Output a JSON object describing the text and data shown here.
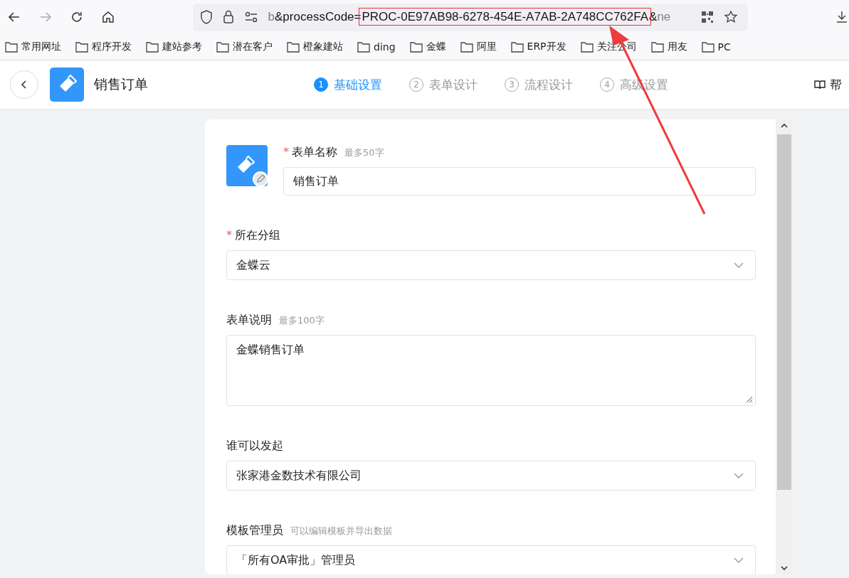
{
  "browser": {
    "url_parts": [
      {
        "text": "b",
        "kind": "faded"
      },
      {
        "text": "&processCode=",
        "kind": "normal"
      },
      {
        "text": "PROC-0E97AB98-6278-454E-A7AB-2A748CC762FA",
        "kind": "highlight"
      },
      {
        "text": "&",
        "kind": "normal"
      },
      {
        "text": "ne",
        "kind": "faded"
      }
    ],
    "bookmarks": [
      "常用网址",
      "程序开发",
      "建站参考",
      "潜在客户",
      "橙象建站",
      "ding",
      "金蝶",
      "阿里",
      "ERP开发",
      "关注公司",
      "用友",
      "PC"
    ]
  },
  "header": {
    "title": "销售订单",
    "help": "帮",
    "steps": [
      {
        "number": "1",
        "label": "基础设置",
        "selected": true
      },
      {
        "number": "2",
        "label": "表单设计",
        "selected": false
      },
      {
        "number": "3",
        "label": "流程设计",
        "selected": false
      },
      {
        "number": "4",
        "label": "高级设置",
        "selected": false
      }
    ]
  },
  "form": {
    "fields": [
      {
        "kind": "name",
        "label": "表单名称",
        "required_mark": "*",
        "hint": "最多50字",
        "value": "销售订单"
      },
      {
        "kind": "select",
        "label": "所在分组",
        "required_mark": "*",
        "value": "金蝶云"
      },
      {
        "kind": "textarea",
        "label": "表单说明",
        "hint": "最多100字",
        "value": "金蝶销售订单"
      },
      {
        "kind": "select",
        "label": "谁可以发起",
        "value": "张家港金数技术有限公司"
      },
      {
        "kind": "select",
        "label": "模板管理员",
        "hint": "可以编辑模板并导出数据",
        "value": "「所有OA审批」管理员"
      }
    ]
  }
}
